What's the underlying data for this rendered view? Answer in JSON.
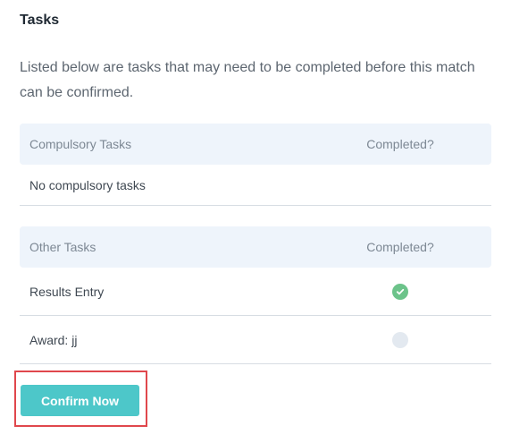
{
  "title": "Tasks",
  "intro": "Listed below are tasks that may need to be completed before this match can be confirmed.",
  "compulsory": {
    "header_task": "Compulsory Tasks",
    "header_completed": "Completed?",
    "empty_text": "No compulsory tasks"
  },
  "other": {
    "header_task": "Other Tasks",
    "header_completed": "Completed?",
    "rows": [
      {
        "label": "Results Entry",
        "completed": true
      },
      {
        "label": "Award: jj",
        "completed": false
      }
    ]
  },
  "confirm_button": "Confirm Now",
  "colors": {
    "accent": "#4dc7c9",
    "success": "#6cc38a",
    "highlight_border": "#e0474c",
    "header_bg": "#eef4fb"
  },
  "icons": {
    "completed": "check-circle-icon",
    "pending": "empty-circle-icon"
  }
}
